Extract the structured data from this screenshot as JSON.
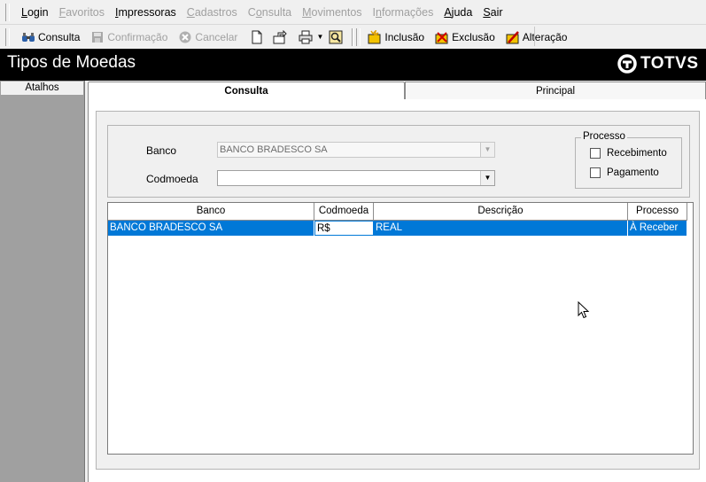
{
  "menu": {
    "items": [
      {
        "label": "Login",
        "underline": "L",
        "disabled": false
      },
      {
        "label": "Favoritos",
        "underline": "F",
        "disabled": true
      },
      {
        "label": "Impressoras",
        "underline": "I",
        "disabled": false
      },
      {
        "label": "Cadastros",
        "underline": "C",
        "disabled": true
      },
      {
        "label": "Consulta",
        "underline": "o",
        "disabled": true
      },
      {
        "label": "Movimentos",
        "underline": "M",
        "disabled": true
      },
      {
        "label": "Informações",
        "underline": "n",
        "disabled": true
      },
      {
        "label": "Ajuda",
        "underline": "A",
        "disabled": false
      },
      {
        "label": "Sair",
        "underline": "S",
        "disabled": false
      }
    ]
  },
  "toolbar": {
    "consulta": "Consulta",
    "confirmacao": "Confirmação",
    "cancelar": "Cancelar",
    "inclusao": "Inclusão",
    "exclusao": "Exclusão",
    "alteracao": "Alteração"
  },
  "window": {
    "title": "Tipos de Moedas",
    "logo_text": "TOTVS"
  },
  "sidebar": {
    "header": "Atalhos"
  },
  "tabs": [
    {
      "label": "Consulta",
      "active": true
    },
    {
      "label": "Principal",
      "active": false
    }
  ],
  "filter": {
    "banco_label": "Banco",
    "banco_value": "BANCO BRADESCO SA",
    "codmoeda_label": "Codmoeda",
    "codmoeda_value": "",
    "processo": {
      "legend": "Processo",
      "recebimento": "Recebimento",
      "pagamento": "Pagamento",
      "recebimento_checked": false,
      "pagamento_checked": false
    }
  },
  "grid": {
    "columns": [
      "Banco",
      "Codmoeda",
      "Descrição",
      "Processo"
    ],
    "rows": [
      {
        "banco": "BANCO BRADESCO SA",
        "codmoeda": "R$",
        "descricao": "REAL",
        "processo": "À Receber",
        "selected": true
      }
    ]
  },
  "colors": {
    "selection": "#0078d7",
    "titlebar": "#000000",
    "disabled_text": "#a0a0a0"
  }
}
